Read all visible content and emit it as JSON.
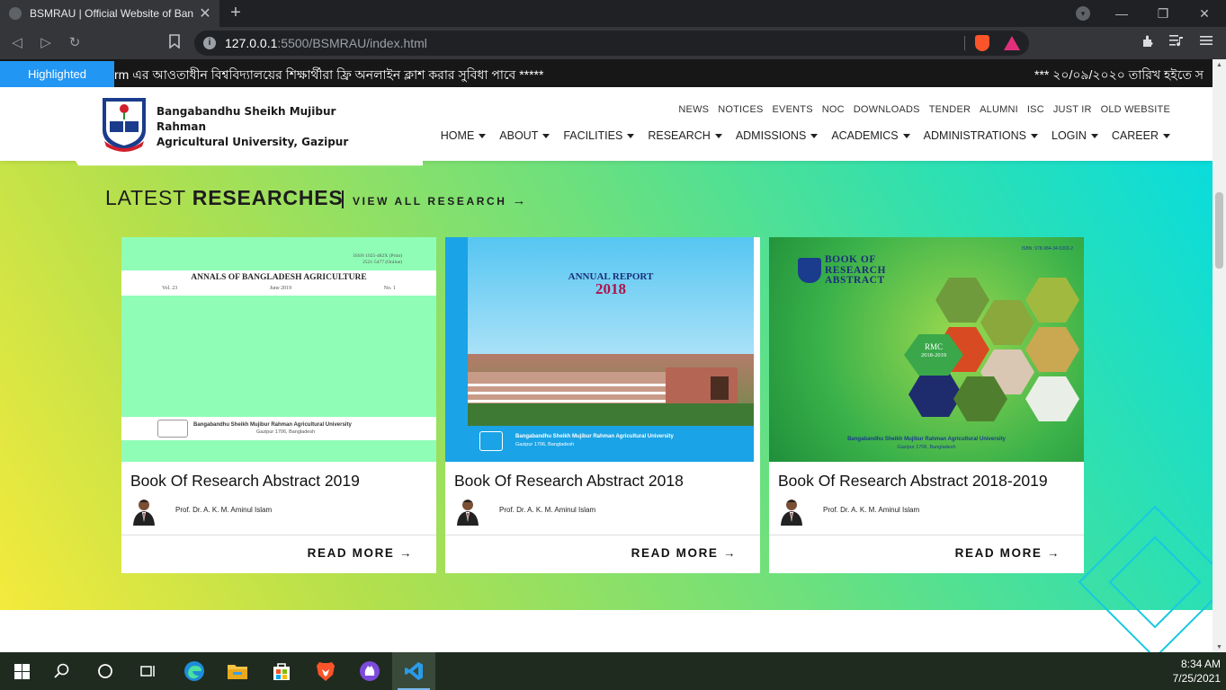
{
  "browser": {
    "tab_title": "BSMRAU | Official Website of Ban",
    "tab_close": "✕",
    "new_tab": "+",
    "url_host": "127.0.0.1",
    "url_path": ":5500/BSMRAU/index.html"
  },
  "ticker": {
    "label": "Highlighted",
    "text": "rm এর আওতাধীন বিশ্ববিদ্যালয়ের শিক্ষার্থীরা ফ্রি অনলাইন ক্লাশ করার সুবিধা পাবে *****",
    "text2": "*** ২০/০৯/২০২০ তারিখ হইতে স"
  },
  "header": {
    "university_name_line1": "Bangabandhu Sheikh Mujibur Rahman",
    "university_name_line2": "Agricultural University, Gazipur",
    "top_nav": [
      "NEWS",
      "NOTICES",
      "EVENTS",
      "NOC",
      "DOWNLOADS",
      "TENDER",
      "ALUMNI",
      "ISC",
      "JUST IR",
      "OLD WEBSITE"
    ],
    "main_nav": [
      "HOME",
      "ABOUT",
      "FACILITIES",
      "RESEARCH",
      "ADMISSIONS",
      "ACADEMICS",
      "ADMINISTRATIONS",
      "LOGIN",
      "CAREER"
    ]
  },
  "research": {
    "title_light": "LATEST ",
    "title_bold": "RESEARCHES",
    "view_all": "VIEW ALL RESEARCH",
    "view_all_arrow": "→",
    "cards": [
      {
        "title": "Book Of Research Abstract 2019",
        "author": "Prof. Dr. A. K. M. Aminul Islam",
        "read_more": "READ MORE",
        "cover": {
          "issn": "ISSN 1025-482X (Print)",
          "issn2": "2521-5477 (Online)",
          "journal": "ANNALS OF BANGLADESH AGRICULTURE",
          "vol": "Vol. 23",
          "date": "June 2019",
          "no": "No. 1",
          "footer1": "Bangabandhu Sheikh Mujibur Rahman Agricultural University",
          "footer2": "Gazipur 1706, Bangladesh"
        }
      },
      {
        "title": "Book Of Research Abstract 2018",
        "author": "Prof. Dr. A. K. M. Aminul Islam",
        "read_more": "READ MORE",
        "cover": {
          "heading": "ANNUAL REPORT",
          "year": "2018",
          "footer1": "Bangabandhu Sheikh Mujibur Rahman Agricultural University",
          "footer2": "Gazipur 1706, Bangladesh"
        }
      },
      {
        "title": "Book Of Research Abstract 2018-2019",
        "author": "Prof. Dr. A. K. M. Aminul Islam",
        "read_more": "READ MORE",
        "cover": {
          "isbn": "ISBN: 978-984-34-5303-2",
          "heading1": "BOOK OF",
          "heading2": "RESEARCH",
          "heading3": "ABSTRACT",
          "badge1": "RMC",
          "badge2": "2018-2019",
          "footer1": "Bangabandhu Sheikh Mujibur Rahman Agricultural University",
          "footer2": "Gazipur 1706, Bangladesh"
        }
      }
    ]
  },
  "taskbar": {
    "time": "8:34 AM",
    "date": "7/25/2021"
  },
  "colors": {
    "ticker_label": "#2196f3",
    "gradient_start": "#f4ea3c",
    "gradient_end": "#0adcdc",
    "deco_diamond": "#17c9e0"
  }
}
